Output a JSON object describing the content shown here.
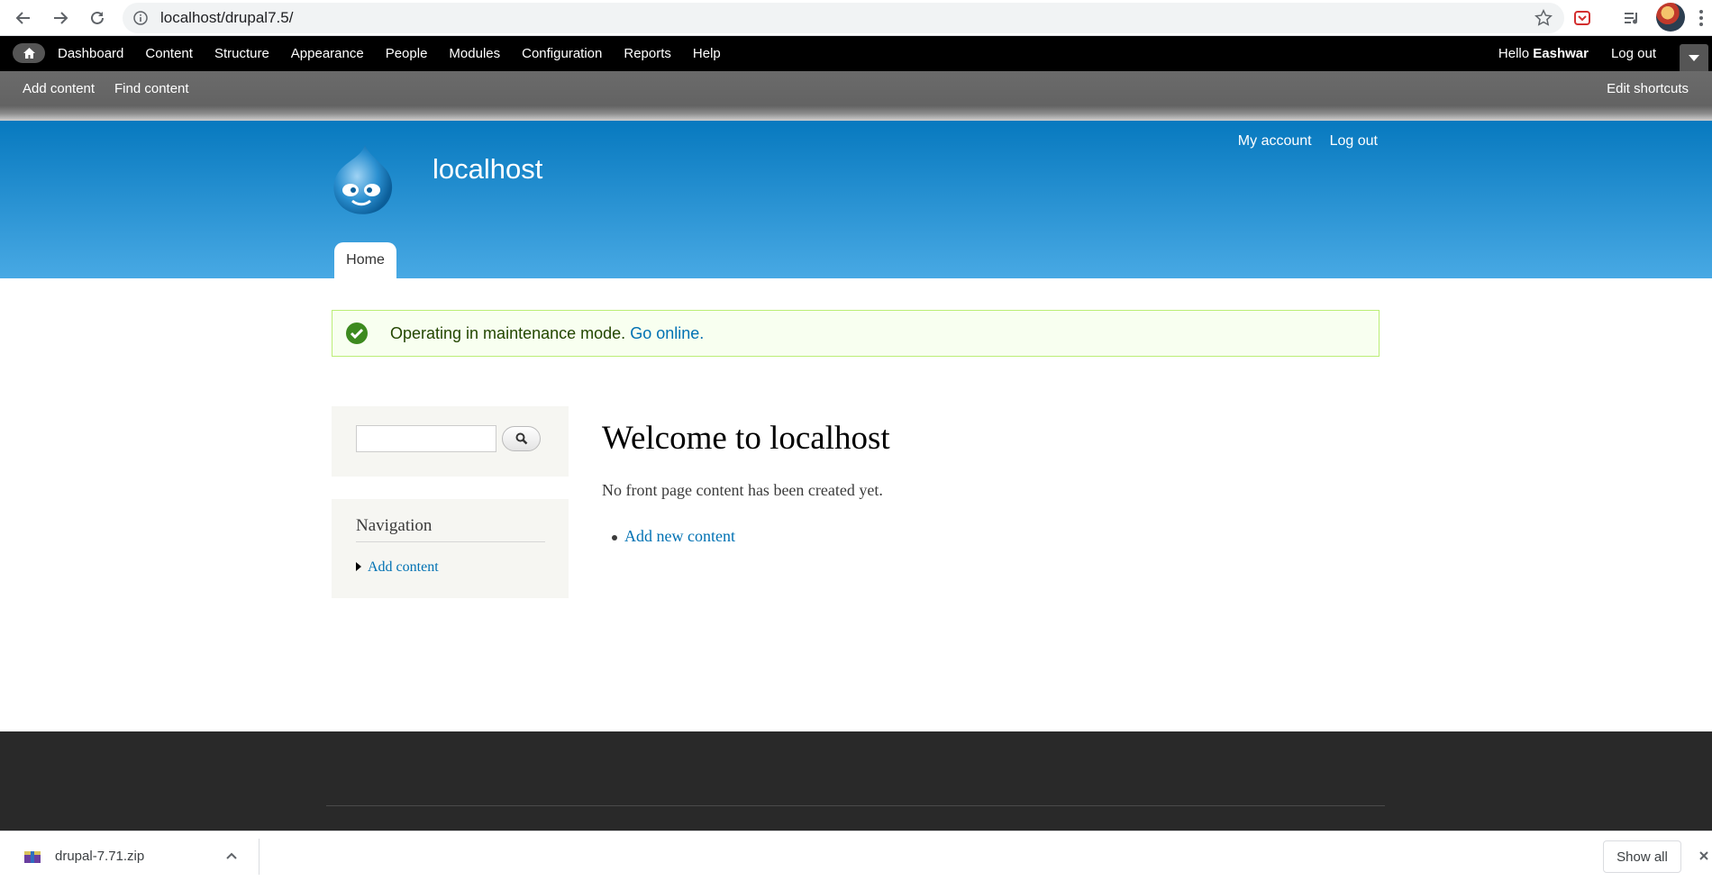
{
  "browser": {
    "url": "localhost/drupal7.5/"
  },
  "admin_toolbar": {
    "menu": [
      "Dashboard",
      "Content",
      "Structure",
      "Appearance",
      "People",
      "Modules",
      "Configuration",
      "Reports",
      "Help"
    ],
    "hello_prefix": "Hello ",
    "username": "Eashwar",
    "logout": "Log out"
  },
  "shortcuts": {
    "add_content": "Add content",
    "find_content": "Find content",
    "edit_shortcuts": "Edit shortcuts"
  },
  "header": {
    "site_name": "localhost",
    "secondary_menu": [
      "My account",
      "Log out"
    ],
    "tab_home": "Home"
  },
  "message": {
    "text": "Operating in maintenance mode.",
    "link": "Go online."
  },
  "sidebar": {
    "nav_title": "Navigation",
    "nav_item": "Add content"
  },
  "content": {
    "title": "Welcome to localhost",
    "empty_text": "No front page content has been created yet.",
    "add_link": "Add new content"
  },
  "downloads": {
    "file_name": "drupal-7.71.zip",
    "show_all": "Show all"
  },
  "colors": {
    "header_top": "#0779bf",
    "header_bottom": "#48a9e4",
    "link": "#0071b3",
    "footer": "#292929"
  }
}
